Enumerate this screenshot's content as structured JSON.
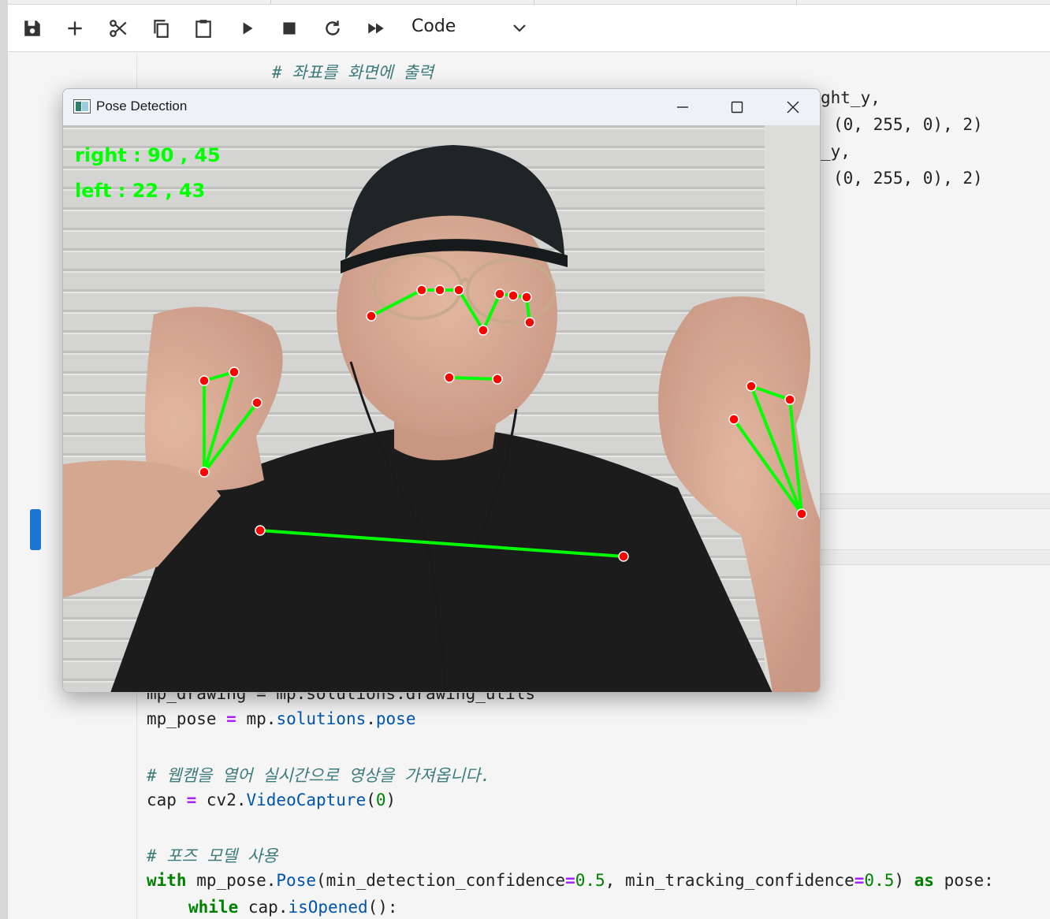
{
  "toolbar": {
    "cell_type": "Code",
    "icons": [
      "save-icon",
      "add-cell-icon",
      "cut-icon",
      "copy-icon",
      "paste-icon",
      "run-icon",
      "stop-icon",
      "restart-icon",
      "fast-forward-icon",
      "chevron-down-icon"
    ]
  },
  "code_above": {
    "comment_coords": "# 좌표를 화면에 출력",
    "line1": "ght_y,",
    "line2_args": "(0, 255, 0), 2)",
    "line3": "_y,",
    "line4_args": "(0, 255, 0), 2)"
  },
  "code_below": {
    "line_drawing": "mp_drawing = mp.solutions.drawing_utils",
    "line_pose_var": "mp_pose",
    "line_pose_mod": "mp",
    "line_pose_attr1": "solutions",
    "line_pose_attr2": "pose",
    "comment_webcam": "# 웹캠을 열어 실시간으로 영상을 가져옵니다.",
    "cap_var": "cap",
    "cap_mod": "cv2",
    "cap_func": "VideoCapture",
    "cap_arg": "0",
    "comment_pose_model": "# 포즈 모델 사용",
    "with_kw": "with",
    "with_obj": "mp_pose",
    "with_func": "Pose",
    "with_param1": "min_detection_confidence",
    "with_val1": "0.5",
    "with_param2": "min_tracking_confidence",
    "with_val2": "0.5",
    "as_kw": "as",
    "as_name": "pose:",
    "while_kw": "while",
    "while_obj": "cap",
    "while_func": "isOpened",
    "while_tail": "():"
  },
  "pose_window": {
    "title": "Pose Detection",
    "overlay_right": "right : 90 , 45",
    "overlay_left": "left : 22 , 43",
    "landmark_color": "#ff0000",
    "connection_color": "#00ff00"
  },
  "colors": {
    "accent": "#1976d2",
    "comment": "#3d7b7b",
    "keyword": "#008000",
    "operator": "#aa22ff"
  }
}
